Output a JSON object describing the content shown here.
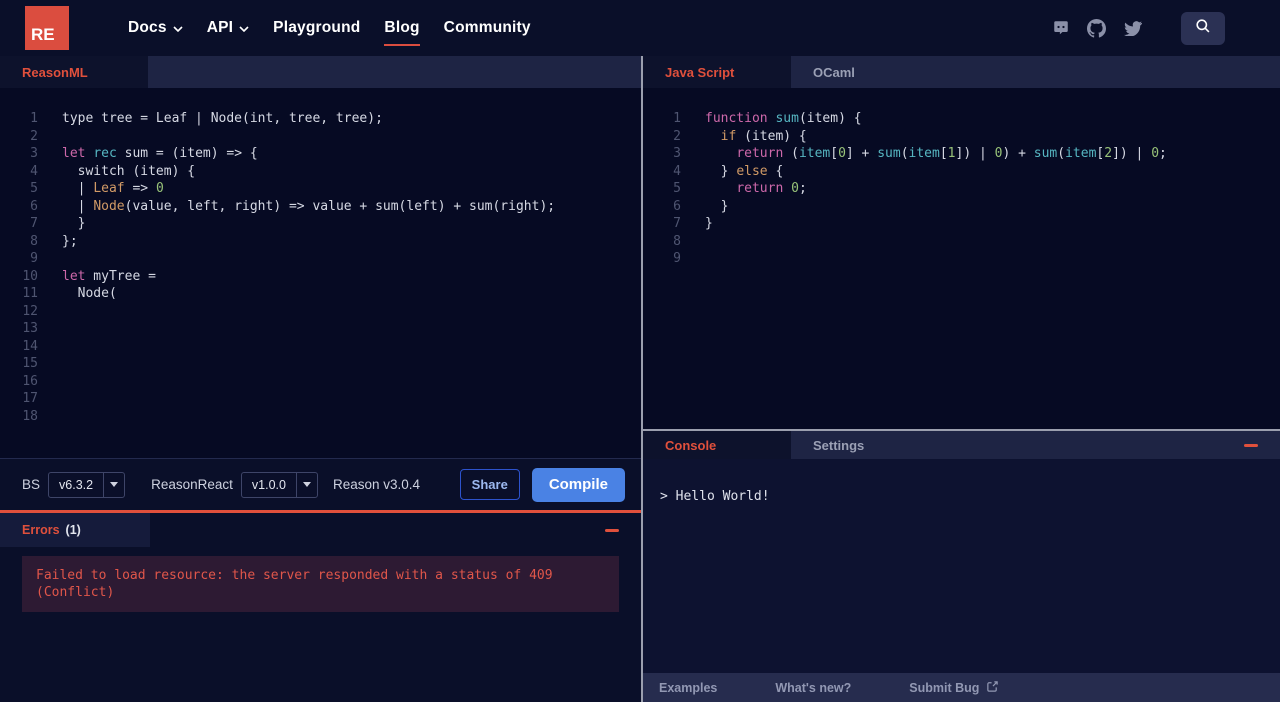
{
  "colors": {
    "accent_red": "#e0503c",
    "logo_red": "#db4d3f",
    "compile_blue": "#4a82e4",
    "share_blue": "#9db9f0",
    "code_keyword": "#cd68aa",
    "code_teal": "#56b6c2",
    "code_orange": "#d19a66",
    "code_number_green": "#98c379",
    "error_box_bg": "#2d1a33"
  },
  "nav": {
    "logo_text": "RE",
    "links": [
      {
        "label": "Docs",
        "has_chevron": true,
        "active": false
      },
      {
        "label": "API",
        "has_chevron": true,
        "active": false
      },
      {
        "label": "Playground",
        "has_chevron": false,
        "active": false
      },
      {
        "label": "Blog",
        "has_chevron": false,
        "active": true
      },
      {
        "label": "Community",
        "has_chevron": false,
        "active": false
      }
    ],
    "social_icons": [
      "discord",
      "github",
      "twitter"
    ],
    "search_icon": "magnifier"
  },
  "left_pane": {
    "tab_label": "ReasonML",
    "editor": {
      "language": "reason",
      "total_lines": 18,
      "lines": [
        [
          [
            "plain",
            "type tree = Leaf | Node(int, tree, tree);"
          ]
        ],
        [],
        [
          [
            "keyword",
            "let"
          ],
          [
            "plain",
            " "
          ],
          [
            "type",
            "rec"
          ],
          [
            "plain",
            " sum = (item) => {"
          ]
        ],
        [
          [
            "plain",
            "  switch (item) {"
          ]
        ],
        [
          [
            "plain",
            "  | "
          ],
          [
            "variant",
            "Leaf"
          ],
          [
            "plain",
            " => "
          ],
          [
            "number",
            "0"
          ]
        ],
        [
          [
            "plain",
            "  | "
          ],
          [
            "variant",
            "Node"
          ],
          [
            "plain",
            "(value, left, right) => value + sum(left) + sum(right);"
          ]
        ],
        [
          [
            "plain",
            "  }"
          ]
        ],
        [
          [
            "plain",
            "};"
          ]
        ],
        [],
        [
          [
            "keyword",
            "let"
          ],
          [
            "plain",
            " myTree ="
          ]
        ],
        [
          [
            "plain",
            "  Node("
          ]
        ],
        [],
        [],
        [],
        [],
        [],
        [],
        []
      ]
    },
    "toolbar": {
      "bs_label": "BS",
      "bs_version": "v6.3.2",
      "reasonreact_label": "ReasonReact",
      "reasonreact_version": "v1.0.0",
      "reason_version_text": "Reason v3.0.4",
      "share_label": "Share",
      "compile_label": "Compile"
    },
    "errors": {
      "title": "Errors",
      "count": "(1)",
      "message": "Failed to load resource: the server responded with a status of 409 (Conflict)"
    }
  },
  "right_pane": {
    "tabs": [
      {
        "label": "Java Script",
        "active": true
      },
      {
        "label": "OCaml",
        "active": false
      }
    ],
    "editor": {
      "language": "javascript",
      "total_lines": 9,
      "lines": [
        [
          [
            "keyword",
            "function"
          ],
          [
            "plain",
            " "
          ],
          [
            "type",
            "sum"
          ],
          [
            "plain",
            "(item) {"
          ]
        ],
        [
          [
            "plain",
            "  "
          ],
          [
            "variant",
            "if"
          ],
          [
            "plain",
            " (item) {"
          ]
        ],
        [
          [
            "plain",
            "    "
          ],
          [
            "keyword",
            "return"
          ],
          [
            "plain",
            " ("
          ],
          [
            "type",
            "item"
          ],
          [
            "plain",
            "["
          ],
          [
            "number",
            "0"
          ],
          [
            "plain",
            "] + "
          ],
          [
            "type",
            "sum"
          ],
          [
            "plain",
            "("
          ],
          [
            "type",
            "item"
          ],
          [
            "plain",
            "["
          ],
          [
            "number",
            "1"
          ],
          [
            "plain",
            "]) | "
          ],
          [
            "number",
            "0"
          ],
          [
            "plain",
            ") + "
          ],
          [
            "type",
            "sum"
          ],
          [
            "plain",
            "("
          ],
          [
            "type",
            "item"
          ],
          [
            "plain",
            "["
          ],
          [
            "number",
            "2"
          ],
          [
            "plain",
            "]) | "
          ],
          [
            "number",
            "0"
          ],
          [
            "plain",
            ";"
          ]
        ],
        [
          [
            "plain",
            "  } "
          ],
          [
            "variant",
            "else"
          ],
          [
            "plain",
            " {"
          ]
        ],
        [
          [
            "plain",
            "    "
          ],
          [
            "keyword",
            "return"
          ],
          [
            "plain",
            " "
          ],
          [
            "number",
            "0"
          ],
          [
            "plain",
            ";"
          ]
        ],
        [
          [
            "plain",
            "  }"
          ]
        ],
        [
          [
            "plain",
            "}"
          ]
        ],
        [],
        []
      ]
    },
    "console": {
      "tabs": [
        {
          "label": "Console",
          "active": true
        },
        {
          "label": "Settings",
          "active": false
        }
      ],
      "output": "> Hello World!"
    },
    "footer": {
      "items": [
        "Examples",
        "What's new?",
        "Submit Bug"
      ]
    }
  }
}
